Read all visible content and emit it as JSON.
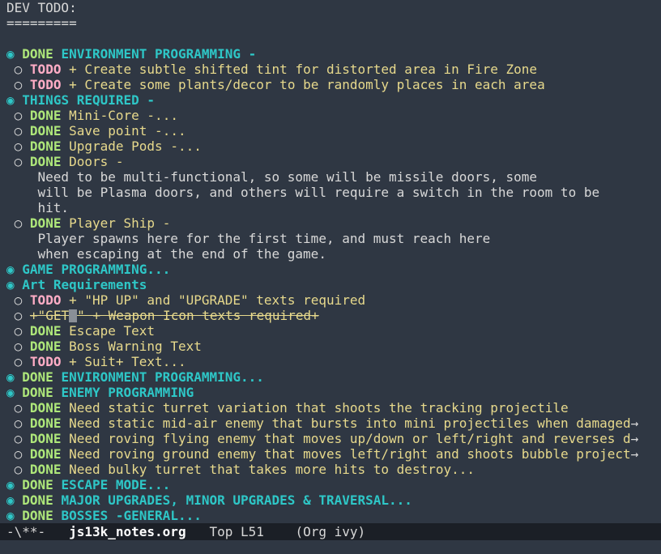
{
  "doc": {
    "title": "DEV TODO:",
    "underline": "=========",
    "bullet_h1": "◉",
    "bullet_h2": "○",
    "kw_done": "DONE",
    "kw_todo": "TODO",
    "s1": {
      "title": "ENVIRONMENT PROGRAMMING -"
    },
    "s1_i1": "+ Create subtle shifted tint for distorted area in Fire Zone",
    "s1_i2": "+ Create some plants/decor to be randomly places in each area",
    "s2": {
      "title": "THINGS REQUIRED -"
    },
    "s2_i1": "Mini-Core -...",
    "s2_i2": "Save point -...",
    "s2_i3": "Upgrade Pods -...",
    "s2_i4": "Doors -",
    "s2_i4_b1": "Need to be multi-functional, so some will be missile doors, some",
    "s2_i4_b2": "will be Plasma doors, and others will require a switch in the room to be",
    "s2_i4_b3": "hit.",
    "s2_i5": "Player Ship -",
    "s2_i5_b1": "Player spawns here for the first time, and must reach here",
    "s2_i5_b2": "when escaping at the end of the game.",
    "s3": {
      "title": "GAME PROGRAMMING..."
    },
    "s4": {
      "title": "Art Requirements"
    },
    "s4_i1": "+ \"HP UP\" and \"UPGRADE\" texts required",
    "s4_i2_pre": "+\"GET",
    "s4_i2_post": "\" + Weapon Icon texts required+",
    "s4_i3": "Escape Text",
    "s4_i4": "Boss Warning Text",
    "s4_i5": "+ Suit+ Text...",
    "s5": {
      "title": "ENVIRONMENT PROGRAMMING..."
    },
    "s6": {
      "title": "ENEMY PROGRAMMING"
    },
    "s6_i1": "Need static turret variation that shoots the tracking projectile",
    "s6_i2": "Need static mid-air enemy that bursts into mini projectiles when damaged",
    "s6_i3": "Need roving flying enemy that moves up/down or left/right and reverses d",
    "s6_i4": "Need roving ground enemy that moves left/right and shoots bubble project",
    "s6_i5": "Need bulky turret that takes more hits to destroy...",
    "trunc_glyph": "→",
    "s7": {
      "title": "ESCAPE MODE..."
    },
    "s8": {
      "title": "MAJOR UPGRADES, MINOR UPGRADES & TRAVERSAL..."
    },
    "s9": {
      "title": "BOSSES -GENERAL..."
    }
  },
  "modeline": {
    "status": "-\\**-",
    "buffer": "js13k_notes.org",
    "position": "Top L51",
    "modes": "(Org ivy)"
  }
}
